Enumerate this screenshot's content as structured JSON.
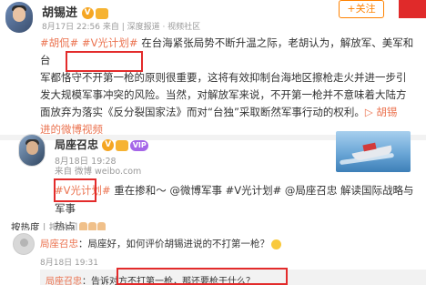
{
  "post1": {
    "author": "胡锡进",
    "vip_badge": "V",
    "meta": "8月17日 22:56 来自 | 深度报道 · 视频社区",
    "follow_label": "+关注",
    "lines": [
      {
        "tags": "#胡侃# #V光计划# ",
        "text": "在台海紧张局势不断升温之际，老胡认为，解放军、美军和台"
      },
      {
        "text": "军都恪守不开第一枪的原则很重要，这将有效抑制台海地区擦枪走火并进一步引"
      },
      {
        "text": "发大规模军事冲突的风险。当然，对解放军来说，不开第一枪并不意味着大陆方"
      },
      {
        "text": "面放弃为落实《反分裂国家法》而对“台独”采取断然军事行动的权利。",
        "tail_link": "▷ 胡锡"
      },
      {
        "link": "进的微博视频"
      }
    ]
  },
  "post2": {
    "author": "局座召忠",
    "vip_badge": "V",
    "vip_label": "VIP",
    "meta_date": "8月18日 19:28",
    "meta_source": "来自 微博 weibo.com",
    "body_tag": "#V光计划#",
    "body_text": " 重在掺和～ @微博军事 #V光计划# @局座召忠  解读国际战略与军事",
    "body_tail": "热点"
  },
  "comments": {
    "sort_label": "按热度",
    "sort_alt": "按时间",
    "first": {
      "author": "局座召忠",
      "text": "：局座好，如何评价胡锡进说的不打第一枪？",
      "meta": "8月18日 19:31",
      "reply_author": "局座召忠",
      "reply_text": "：告诉对方不打第一枪，那还要枪干什么？"
    }
  },
  "colors": {
    "accent": "#eb7350",
    "highlight_box": "#e32b2b",
    "follow": "#ff8200"
  }
}
